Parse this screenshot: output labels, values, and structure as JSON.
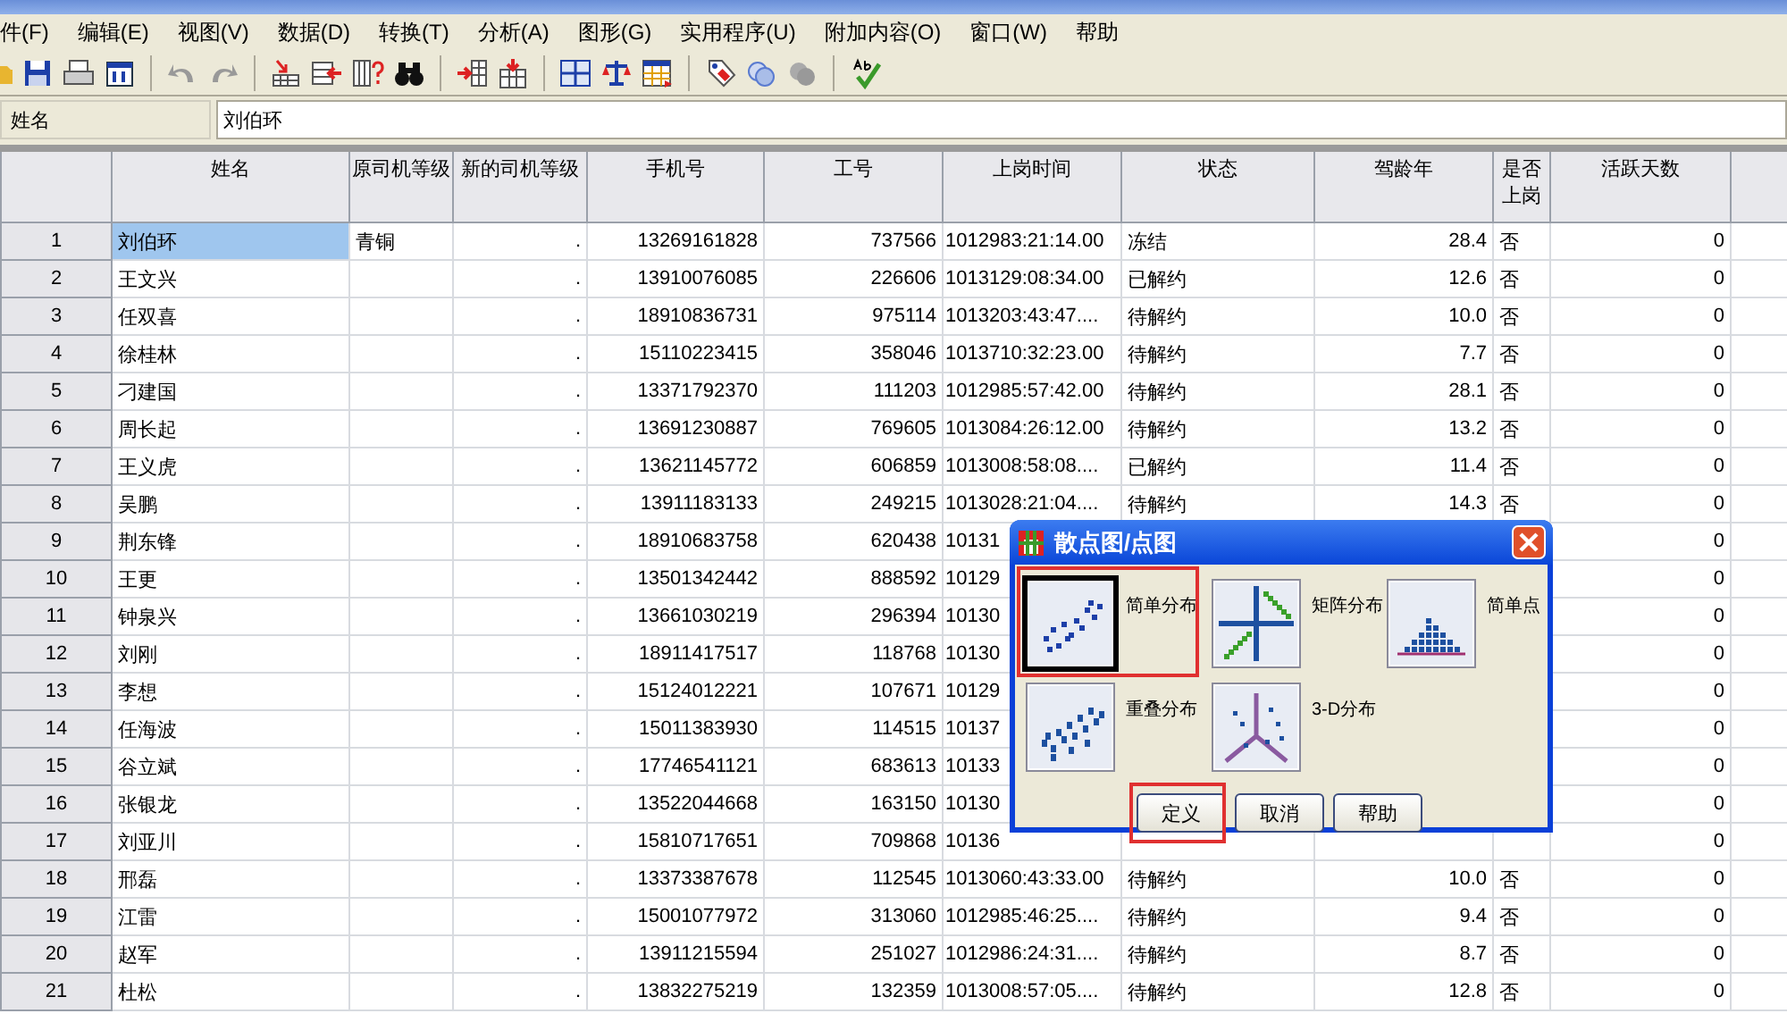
{
  "menu_bar": [
    "件(F)",
    "编辑(E)",
    "视图(V)",
    "数据(D)",
    "转换(T)",
    "分析(A)",
    "图形(G)",
    "实用程序(U)",
    "附加内容(O)",
    "窗口(W)",
    "帮助"
  ],
  "cell_editor": {
    "label": "姓名",
    "value": "刘伯环"
  },
  "table": {
    "columns": [
      {
        "label": "姓名",
        "kind": "text"
      },
      {
        "label": "原司机等级",
        "kind": "text"
      },
      {
        "label": "新的司机等级",
        "kind": "number"
      },
      {
        "label": "手机号",
        "kind": "number"
      },
      {
        "label": "工号",
        "kind": "number"
      },
      {
        "label": "上岗时间",
        "kind": "time"
      },
      {
        "label": "状态",
        "kind": "text"
      },
      {
        "label": "驾龄年",
        "kind": "number"
      },
      {
        "label": "是否上岗",
        "kind": "text"
      },
      {
        "label": "活跃天数",
        "kind": "number"
      }
    ],
    "rows": [
      {
        "number": "1",
        "selected": true,
        "cells": [
          "刘伯环",
          "青铜",
          ".",
          "13269161828",
          "737566",
          "1012983:21:14.00",
          "冻结",
          "28.4",
          "否",
          "0"
        ]
      },
      {
        "number": "2",
        "selected": false,
        "cells": [
          "王文兴",
          null,
          ".",
          "13910076085",
          "226606",
          "1013129:08:34.00",
          "已解约",
          "12.6",
          "否",
          "0"
        ]
      },
      {
        "number": "3",
        "selected": false,
        "cells": [
          "任双喜",
          null,
          ".",
          "18910836731",
          "975114",
          "1013203:43:47....",
          "待解约",
          "10.0",
          "否",
          "0"
        ]
      },
      {
        "number": "4",
        "selected": false,
        "cells": [
          "徐桂林",
          null,
          ".",
          "15110223415",
          "358046",
          "1013710:32:23.00",
          "待解约",
          "7.7",
          "否",
          "0"
        ]
      },
      {
        "number": "5",
        "selected": false,
        "cells": [
          "刁建国",
          null,
          ".",
          "13371792370",
          "111203",
          "1012985:57:42.00",
          "待解约",
          "28.1",
          "否",
          "0"
        ]
      },
      {
        "number": "6",
        "selected": false,
        "cells": [
          "周长起",
          null,
          ".",
          "13691230887",
          "769605",
          "1013084:26:12.00",
          "待解约",
          "13.2",
          "否",
          "0"
        ]
      },
      {
        "number": "7",
        "selected": false,
        "cells": [
          "王义虎",
          null,
          ".",
          "13621145772",
          "606859",
          "1013008:58:08....",
          "已解约",
          "11.4",
          "否",
          "0"
        ]
      },
      {
        "number": "8",
        "selected": false,
        "cells": [
          "吴鹏",
          null,
          ".",
          "13911183133",
          "249215",
          "1013028:21:04....",
          "待解约",
          "14.3",
          "否",
          "0"
        ]
      },
      {
        "number": "9",
        "selected": false,
        "cells": [
          "荆东锋",
          null,
          ".",
          "18910683758",
          "620438",
          "10131",
          null,
          null,
          null,
          "0"
        ]
      },
      {
        "number": "10",
        "selected": false,
        "cells": [
          "王更",
          null,
          ".",
          "13501342442",
          "888592",
          "10129",
          null,
          null,
          null,
          "0"
        ]
      },
      {
        "number": "11",
        "selected": false,
        "cells": [
          "钟泉兴",
          null,
          ".",
          "13661030219",
          "296394",
          "10130",
          null,
          null,
          null,
          "0"
        ]
      },
      {
        "number": "12",
        "selected": false,
        "cells": [
          "刘刚",
          null,
          ".",
          "18911417517",
          "118768",
          "10130",
          null,
          null,
          null,
          "0"
        ]
      },
      {
        "number": "13",
        "selected": false,
        "cells": [
          "李想",
          null,
          ".",
          "15124012221",
          "107671",
          "10129",
          null,
          null,
          null,
          "0"
        ]
      },
      {
        "number": "14",
        "selected": false,
        "cells": [
          "任海波",
          null,
          ".",
          "15011383930",
          "114515",
          "10137",
          null,
          null,
          null,
          "0"
        ]
      },
      {
        "number": "15",
        "selected": false,
        "cells": [
          "谷立斌",
          null,
          ".",
          "17746541121",
          "683613",
          "10133",
          null,
          null,
          null,
          "0"
        ]
      },
      {
        "number": "16",
        "selected": false,
        "cells": [
          "张银龙",
          null,
          ".",
          "13522044668",
          "163150",
          "10130",
          null,
          null,
          null,
          "0"
        ]
      },
      {
        "number": "17",
        "selected": false,
        "cells": [
          "刘亚川",
          null,
          ".",
          "15810717651",
          "709868",
          "10136",
          null,
          null,
          null,
          "0"
        ]
      },
      {
        "number": "18",
        "selected": false,
        "cells": [
          "邢磊",
          null,
          ".",
          "13373387678",
          "112545",
          "1013060:43:33.00",
          "待解约",
          "10.0",
          "否",
          "0"
        ]
      },
      {
        "number": "19",
        "selected": false,
        "cells": [
          "江雷",
          null,
          ".",
          "15001077972",
          "313060",
          "1012985:46:25....",
          "待解约",
          "9.4",
          "否",
          "0"
        ]
      },
      {
        "number": "20",
        "selected": false,
        "cells": [
          "赵军",
          null,
          ".",
          "13911215594",
          "251027",
          "1012986:24:31....",
          "待解约",
          "8.7",
          "否",
          "0"
        ]
      },
      {
        "number": "21",
        "selected": false,
        "cells": [
          "杜松",
          null,
          ".",
          "13832275219",
          "132359",
          "1013008:57:05....",
          "待解约",
          "12.8",
          "否",
          "0"
        ]
      }
    ]
  },
  "dialog": {
    "title": "散点图/点图",
    "options": [
      {
        "label": "简单分布",
        "kind": "simple-scatter",
        "selected": true,
        "annotated": true
      },
      {
        "label": "矩阵分布",
        "kind": "matrix",
        "selected": false,
        "annotated": false
      },
      {
        "label": "简单点",
        "kind": "dot",
        "selected": false,
        "annotated": false
      },
      {
        "label": "重叠分布",
        "kind": "overlay",
        "selected": false,
        "annotated": false
      },
      {
        "label": "3-D分布",
        "kind": "three-d",
        "selected": false,
        "annotated": false
      }
    ],
    "buttons": [
      {
        "label": "定义",
        "annotated": true
      },
      {
        "label": "取消",
        "annotated": false
      },
      {
        "label": "帮助",
        "annotated": false
      }
    ]
  }
}
